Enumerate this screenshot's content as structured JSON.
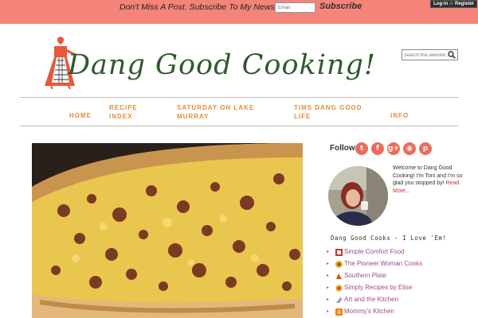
{
  "newsletter": {
    "prompt": "Don't Miss A Post. Subscribe To My Newsletter!",
    "email_placeholder": "Email",
    "subscribe_label": "Subscribe"
  },
  "account": {
    "login": "Log-in",
    "or": "or",
    "register": "Register"
  },
  "site": {
    "title": "Dang Good Cooking!"
  },
  "search": {
    "placeholder": "Search this website…"
  },
  "nav": {
    "home": "HOME",
    "recipe_index_1": "RECIPE",
    "recipe_index_2": "INDEX",
    "lake_murray_1": "SATURDAY ON LAKE",
    "lake_murray_2": "MURRAY",
    "dang_good_life_1": "TIMS DANG GOOD",
    "dang_good_life_2": "LIFE",
    "info": "INFO"
  },
  "sidebar": {
    "follow_label": "Follow:",
    "social": [
      "twitter-icon",
      "facebook-icon",
      "google-plus-icon",
      "rss-icon",
      "pinterest-icon"
    ],
    "welcome_text": "Welcome to Dang Good Cooking! I'm Toni and I'm so glad you stopped by!",
    "read_more": "Read More...",
    "blogroll_title": "Dang Good Cooks - I Love 'Em!",
    "blogroll": [
      {
        "label": "Simple Comfort Food"
      },
      {
        "label": "The Pioneer Woman Cooks"
      },
      {
        "label": "Southern Plate"
      },
      {
        "label": "Simply Recipes by Elise"
      },
      {
        "label": "Art and the Kitchen"
      },
      {
        "label": "Mommy's Kitchen"
      }
    ]
  },
  "colors": {
    "topbar": "#f4847a",
    "title_green": "#2f5a2b",
    "nav_orange": "#e38b3d",
    "link_purple": "#a04a8a",
    "social_red": "#ef6a5a"
  }
}
